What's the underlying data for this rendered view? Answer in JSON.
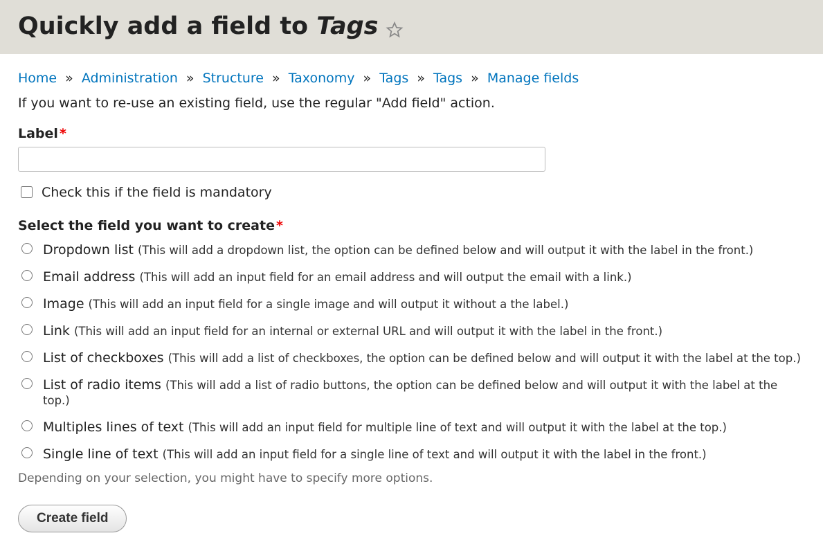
{
  "header": {
    "title_prefix": "Quickly add a field to ",
    "title_italic": "Tags"
  },
  "breadcrumb": {
    "items": [
      {
        "label": "Home"
      },
      {
        "label": "Administration"
      },
      {
        "label": "Structure"
      },
      {
        "label": "Taxonomy"
      },
      {
        "label": "Tags"
      },
      {
        "label": "Tags"
      },
      {
        "label": "Manage fields"
      }
    ],
    "separator": "»"
  },
  "intro": "If you want to re-use an existing field, use the regular \"Add field\" action.",
  "form": {
    "label_field": {
      "label": "Label",
      "value": ""
    },
    "mandatory_checkbox": {
      "label": "Check this if the field is mandatory",
      "checked": false
    },
    "field_type": {
      "legend": "Select the field you want to create",
      "options": [
        {
          "label": "Dropdown list",
          "desc": "(This will add a dropdown list, the option can be defined below and will output it with the label in the front.)"
        },
        {
          "label": "Email address",
          "desc": "(This will add an input field for an email address and will output the email with a link.)"
        },
        {
          "label": "Image",
          "desc": "(This will add an input field for a single image and will output it without a the label.)"
        },
        {
          "label": "Link",
          "desc": "(This will add an input field for an internal or external URL and will output it with the label in the front.)"
        },
        {
          "label": "List of checkboxes",
          "desc": "(This will add a list of checkboxes, the option can be defined below and will output it with the label at the top.)"
        },
        {
          "label": "List of radio items",
          "desc": "(This will add a list of radio buttons, the option can be defined below and will output it with the label at the top.)"
        },
        {
          "label": "Multiples lines of text",
          "desc": "(This will add an input field for multiple line of text and will output it with the label at the top.)"
        },
        {
          "label": "Single line of text",
          "desc": "(This will add an input field for a single line of text and will output it with the label in the front.)"
        }
      ],
      "help": "Depending on your selection, you might have to specify more options."
    },
    "submit_label": "Create field"
  }
}
